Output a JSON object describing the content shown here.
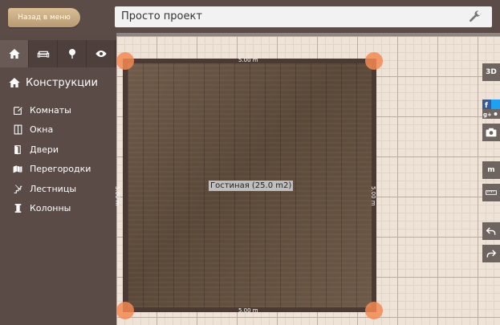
{
  "header": {
    "back_label": "Назад в меню",
    "project_title": "Просто проект",
    "settings_icon": "wrench-icon"
  },
  "sidebar": {
    "tabs": [
      {
        "icon": "home-icon"
      },
      {
        "icon": "sofa-icon"
      },
      {
        "icon": "tree-icon"
      },
      {
        "icon": "eye-icon"
      }
    ],
    "section_title": "Конструкции",
    "items": [
      {
        "label": "Комнаты",
        "icon": "room-icon"
      },
      {
        "label": "Окна",
        "icon": "window-icon"
      },
      {
        "label": "Двери",
        "icon": "door-icon"
      },
      {
        "label": "Перегородки",
        "icon": "partition-icon"
      },
      {
        "label": "Лестницы",
        "icon": "stairs-icon"
      },
      {
        "label": "Колонны",
        "icon": "column-icon"
      }
    ]
  },
  "plan": {
    "room_label": "Гостиная (25.0 m2)",
    "dim_top": "5.00 m",
    "dim_bottom": "5.00 m",
    "dim_left": "5.00 m",
    "dim_right": "5.00 m"
  },
  "right_toolbar": {
    "view3d_label": "3D",
    "units_label": "m"
  },
  "colors": {
    "accent_corner": "#f38954",
    "sidebar_bg": "#5a4b47",
    "back_button": "#c9ab80"
  }
}
